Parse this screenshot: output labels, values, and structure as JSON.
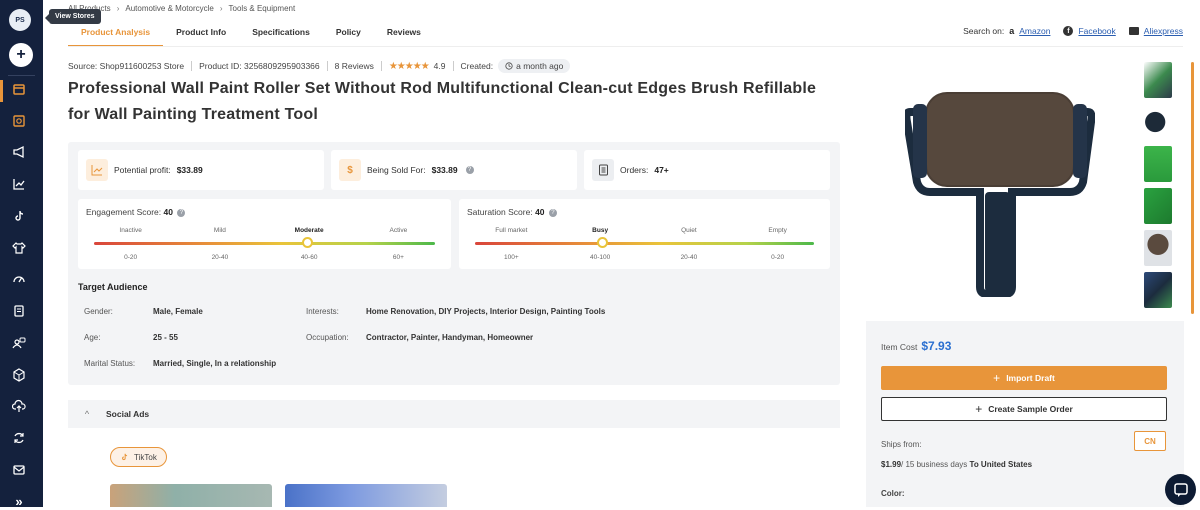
{
  "sidebar": {
    "avatar_initials": "PS",
    "tooltip": "View Stores",
    "plus_label": "+",
    "expand_label": "»"
  },
  "breadcrumb": [
    "All Products",
    "Automotive & Motorcycle",
    "Tools & Equipment"
  ],
  "tabs": [
    "Product Analysis",
    "Product Info",
    "Specifications",
    "Policy",
    "Reviews"
  ],
  "search_on": {
    "label": "Search on:",
    "amazon": "Amazon",
    "facebook": "Facebook",
    "aliexpress": "Aliexpress"
  },
  "meta": {
    "source": "Source: Shop911600253 Store",
    "product_id": "Product ID: 3256809295903366",
    "reviews": "8 Reviews",
    "stars": "★★★★★",
    "rating": "4.9",
    "created_label": "Created:",
    "created_value": "a month ago"
  },
  "product_title": "Professional Wall Paint Roller Set Without Rod Multifunctional Clean-cut Edges Brush Refillable for Wall Painting Treatment Tool",
  "stats": {
    "profit_label": "Potential profit:",
    "profit_value": "$33.89",
    "sold_label": "Being Sold For:",
    "sold_value": "$33.89",
    "orders_label": "Orders:",
    "orders_value": "47+",
    "dollar_glyph": "$"
  },
  "engagement": {
    "label": "Engagement Score:",
    "score": "40",
    "levels": [
      "Inactive",
      "Mild",
      "Moderate",
      "Active"
    ],
    "ranges": [
      "0-20",
      "20-40",
      "40-60",
      "60+"
    ],
    "selected_index": 2,
    "knob_fraction": 0.625
  },
  "saturation": {
    "label": "Saturation Score:",
    "score": "40",
    "levels": [
      "Full market",
      "Busy",
      "Quiet",
      "Empty"
    ],
    "ranges": [
      "100+",
      "40-100",
      "20-40",
      "0-20"
    ],
    "selected_index": 1,
    "knob_fraction": 0.375
  },
  "target_audience": {
    "title": "Target Audience",
    "gender_label": "Gender:",
    "gender_value": "Male, Female",
    "interests_label": "Interests:",
    "interests_value": "Home Renovation, DIY Projects, Interior Design, Painting Tools",
    "age_label": "Age:",
    "age_value": "25 - 55",
    "occupation_label": "Occupation:",
    "occupation_value": "Contractor, Painter, Handyman, Homeowner",
    "marital_label": "Marital Status:",
    "marital_value": "Married, Single, In a relationship"
  },
  "social_ads": {
    "title": "Social Ads",
    "platform": "TikTok"
  },
  "buy": {
    "cost_label": "Item Cost",
    "cost_value": "$7.93",
    "import_label": "Import Draft",
    "sample_label": "Create Sample Order",
    "ships_from_label": "Ships from:",
    "ships_country": "CN",
    "ship_price": "$1.99",
    "ship_days": "/ 15 business days",
    "ship_dest": "To United States",
    "color_label": "Color:"
  },
  "colors": {
    "accent": "#e8953a",
    "sidebar": "#14213d",
    "link": "#2a5db0",
    "price": "#2a6fd0"
  }
}
